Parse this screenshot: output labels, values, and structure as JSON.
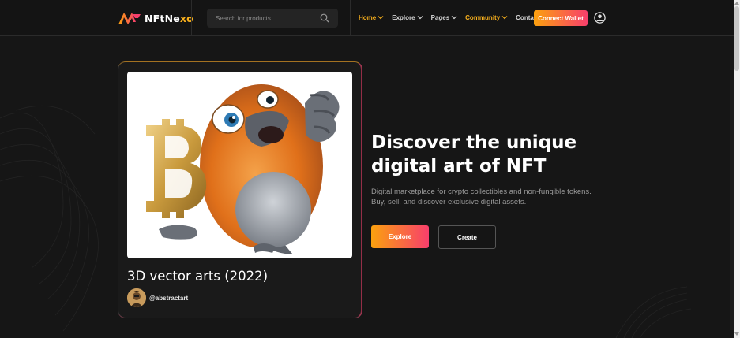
{
  "brand": {
    "logo_text_main": "NFtNe",
    "logo_text_accent": "xo",
    "accent_color": "#fbb21d",
    "gradient_start": "#fba10e",
    "gradient_end": "#f83f6c"
  },
  "search": {
    "placeholder": "Search for products...",
    "value": "",
    "icon": "search-icon"
  },
  "nav": {
    "items": [
      {
        "label": "Home",
        "active": true,
        "has_dropdown": true
      },
      {
        "label": "Explore",
        "active": false,
        "has_dropdown": true
      },
      {
        "label": "Pages",
        "active": false,
        "has_dropdown": true
      },
      {
        "label": "Community",
        "active": true,
        "has_dropdown": true
      },
      {
        "label": "Contact",
        "active": false,
        "has_dropdown": false
      }
    ],
    "connect_label": "Connect Wallet",
    "user_icon": "user-circle-icon"
  },
  "card": {
    "title": "3D vector arts (2022)",
    "username": "@abstractart"
  },
  "hero": {
    "title_line1": "Discover the unique",
    "title_line2": "digital art of NFT",
    "subtitle_line1": "Digital marketplace for crypto collectibles and non-fungible tokens.",
    "subtitle_line2": "Buy, sell, and discover exclusive digital assets.",
    "explore_label": "Explore",
    "create_label": "Create"
  }
}
